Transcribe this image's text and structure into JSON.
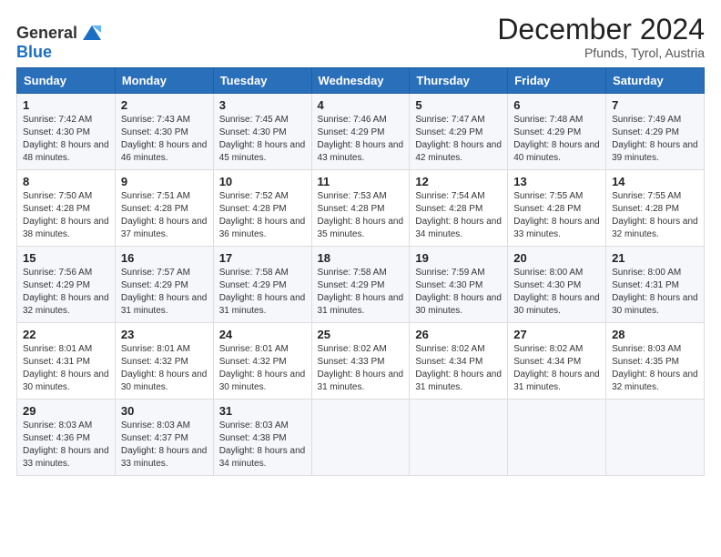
{
  "logo": {
    "text_general": "General",
    "text_blue": "Blue"
  },
  "header": {
    "month": "December 2024",
    "location": "Pfunds, Tyrol, Austria"
  },
  "weekdays": [
    "Sunday",
    "Monday",
    "Tuesday",
    "Wednesday",
    "Thursday",
    "Friday",
    "Saturday"
  ],
  "weeks": [
    [
      {
        "day": "1",
        "sunrise": "7:42 AM",
        "sunset": "4:30 PM",
        "daylight": "8 hours and 48 minutes."
      },
      {
        "day": "2",
        "sunrise": "7:43 AM",
        "sunset": "4:30 PM",
        "daylight": "8 hours and 46 minutes."
      },
      {
        "day": "3",
        "sunrise": "7:45 AM",
        "sunset": "4:30 PM",
        "daylight": "8 hours and 45 minutes."
      },
      {
        "day": "4",
        "sunrise": "7:46 AM",
        "sunset": "4:29 PM",
        "daylight": "8 hours and 43 minutes."
      },
      {
        "day": "5",
        "sunrise": "7:47 AM",
        "sunset": "4:29 PM",
        "daylight": "8 hours and 42 minutes."
      },
      {
        "day": "6",
        "sunrise": "7:48 AM",
        "sunset": "4:29 PM",
        "daylight": "8 hours and 40 minutes."
      },
      {
        "day": "7",
        "sunrise": "7:49 AM",
        "sunset": "4:29 PM",
        "daylight": "8 hours and 39 minutes."
      }
    ],
    [
      {
        "day": "8",
        "sunrise": "7:50 AM",
        "sunset": "4:28 PM",
        "daylight": "8 hours and 38 minutes."
      },
      {
        "day": "9",
        "sunrise": "7:51 AM",
        "sunset": "4:28 PM",
        "daylight": "8 hours and 37 minutes."
      },
      {
        "day": "10",
        "sunrise": "7:52 AM",
        "sunset": "4:28 PM",
        "daylight": "8 hours and 36 minutes."
      },
      {
        "day": "11",
        "sunrise": "7:53 AM",
        "sunset": "4:28 PM",
        "daylight": "8 hours and 35 minutes."
      },
      {
        "day": "12",
        "sunrise": "7:54 AM",
        "sunset": "4:28 PM",
        "daylight": "8 hours and 34 minutes."
      },
      {
        "day": "13",
        "sunrise": "7:55 AM",
        "sunset": "4:28 PM",
        "daylight": "8 hours and 33 minutes."
      },
      {
        "day": "14",
        "sunrise": "7:55 AM",
        "sunset": "4:28 PM",
        "daylight": "8 hours and 32 minutes."
      }
    ],
    [
      {
        "day": "15",
        "sunrise": "7:56 AM",
        "sunset": "4:29 PM",
        "daylight": "8 hours and 32 minutes."
      },
      {
        "day": "16",
        "sunrise": "7:57 AM",
        "sunset": "4:29 PM",
        "daylight": "8 hours and 31 minutes."
      },
      {
        "day": "17",
        "sunrise": "7:58 AM",
        "sunset": "4:29 PM",
        "daylight": "8 hours and 31 minutes."
      },
      {
        "day": "18",
        "sunrise": "7:58 AM",
        "sunset": "4:29 PM",
        "daylight": "8 hours and 31 minutes."
      },
      {
        "day": "19",
        "sunrise": "7:59 AM",
        "sunset": "4:30 PM",
        "daylight": "8 hours and 30 minutes."
      },
      {
        "day": "20",
        "sunrise": "8:00 AM",
        "sunset": "4:30 PM",
        "daylight": "8 hours and 30 minutes."
      },
      {
        "day": "21",
        "sunrise": "8:00 AM",
        "sunset": "4:31 PM",
        "daylight": "8 hours and 30 minutes."
      }
    ],
    [
      {
        "day": "22",
        "sunrise": "8:01 AM",
        "sunset": "4:31 PM",
        "daylight": "8 hours and 30 minutes."
      },
      {
        "day": "23",
        "sunrise": "8:01 AM",
        "sunset": "4:32 PM",
        "daylight": "8 hours and 30 minutes."
      },
      {
        "day": "24",
        "sunrise": "8:01 AM",
        "sunset": "4:32 PM",
        "daylight": "8 hours and 30 minutes."
      },
      {
        "day": "25",
        "sunrise": "8:02 AM",
        "sunset": "4:33 PM",
        "daylight": "8 hours and 31 minutes."
      },
      {
        "day": "26",
        "sunrise": "8:02 AM",
        "sunset": "4:34 PM",
        "daylight": "8 hours and 31 minutes."
      },
      {
        "day": "27",
        "sunrise": "8:02 AM",
        "sunset": "4:34 PM",
        "daylight": "8 hours and 31 minutes."
      },
      {
        "day": "28",
        "sunrise": "8:03 AM",
        "sunset": "4:35 PM",
        "daylight": "8 hours and 32 minutes."
      }
    ],
    [
      {
        "day": "29",
        "sunrise": "8:03 AM",
        "sunset": "4:36 PM",
        "daylight": "8 hours and 33 minutes."
      },
      {
        "day": "30",
        "sunrise": "8:03 AM",
        "sunset": "4:37 PM",
        "daylight": "8 hours and 33 minutes."
      },
      {
        "day": "31",
        "sunrise": "8:03 AM",
        "sunset": "4:38 PM",
        "daylight": "8 hours and 34 minutes."
      },
      null,
      null,
      null,
      null
    ]
  ]
}
